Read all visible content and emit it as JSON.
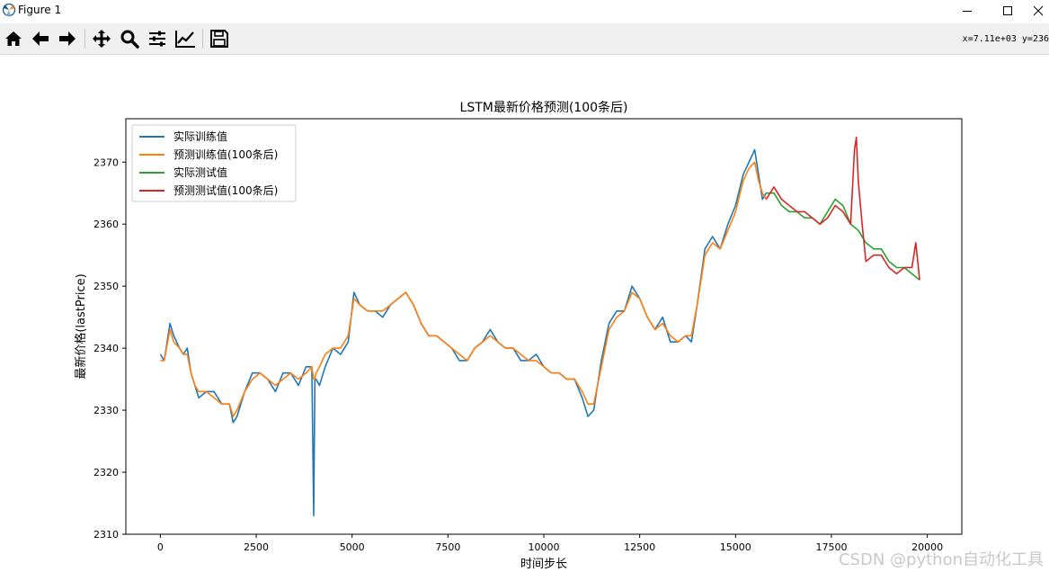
{
  "window": {
    "title": "Figure 1",
    "minimize_label": "minimize",
    "maximize_label": "maximize",
    "close_label": "close"
  },
  "toolbar": {
    "buttons": [
      {
        "name": "home",
        "icon": "home-icon"
      },
      {
        "name": "back",
        "icon": "arrow-left-icon"
      },
      {
        "name": "forward",
        "icon": "arrow-right-icon"
      },
      {
        "name": "pan",
        "icon": "move-icon"
      },
      {
        "name": "zoom",
        "icon": "magnifier-icon"
      },
      {
        "name": "subplots",
        "icon": "sliders-icon"
      },
      {
        "name": "edit-axes",
        "icon": "line-chart-icon"
      },
      {
        "name": "save",
        "icon": "floppy-icon"
      }
    ],
    "coords": "x=7.11e+03 y=236"
  },
  "watermark": "CSDN @python自动化工具",
  "chart_data": {
    "type": "line",
    "title": "LSTM最新价格预测(100条后)",
    "xlabel": "时间步长",
    "ylabel": "最新价格(lastPrice)",
    "xlim": [
      -900,
      20900
    ],
    "ylim": [
      2310,
      2377
    ],
    "xticks": [
      0,
      2500,
      5000,
      7500,
      10000,
      12500,
      15000,
      17500,
      20000
    ],
    "xtick_labels": [
      "0",
      "2500",
      "5000",
      "7500",
      "10000",
      "12500",
      "15000",
      "17500",
      "20000"
    ],
    "yticks": [
      2310,
      2320,
      2330,
      2340,
      2350,
      2360,
      2370
    ],
    "ytick_labels": [
      "2310",
      "2320",
      "2330",
      "2340",
      "2350",
      "2360",
      "2370"
    ],
    "grid": false,
    "legend_position": "upper-left",
    "series": [
      {
        "name": "实际训练值",
        "color": "#1f77b4",
        "x": [
          0,
          100,
          250,
          350,
          500,
          600,
          700,
          800,
          900,
          1000,
          1200,
          1400,
          1600,
          1800,
          1900,
          2000,
          2200,
          2400,
          2600,
          2800,
          3000,
          3200,
          3400,
          3600,
          3800,
          3950,
          4000,
          4030,
          4060,
          4150,
          4300,
          4500,
          4700,
          4900,
          5050,
          5200,
          5400,
          5600,
          5800,
          6000,
          6200,
          6400,
          6600,
          6800,
          7000,
          7200,
          7400,
          7600,
          7800,
          8000,
          8200,
          8400,
          8600,
          8800,
          9000,
          9200,
          9400,
          9600,
          9800,
          10000,
          10200,
          10400,
          10600,
          10800,
          11000,
          11150,
          11300,
          11500,
          11700,
          11900,
          12100,
          12300,
          12500,
          12700,
          12900,
          13100,
          13300,
          13500,
          13700,
          13850,
          14000,
          14200,
          14400,
          14600,
          14800,
          15000,
          15200,
          15350,
          15500,
          15600,
          15700,
          15800
        ],
        "y": [
          2339,
          2338,
          2344,
          2342,
          2340,
          2339,
          2340,
          2336,
          2334,
          2332,
          2333,
          2333,
          2331,
          2331,
          2328,
          2329,
          2333,
          2336,
          2336,
          2335,
          2333,
          2336,
          2336,
          2334,
          2337,
          2337,
          2313,
          2335,
          2335,
          2334,
          2337,
          2340,
          2339,
          2341,
          2349,
          2347,
          2346,
          2346,
          2345,
          2347,
          2348,
          2349,
          2347,
          2344,
          2342,
          2342,
          2341,
          2340,
          2338,
          2338,
          2340,
          2341,
          2343,
          2341,
          2340,
          2340,
          2338,
          2338,
          2339,
          2337,
          2336,
          2336,
          2335,
          2335,
          2332,
          2329,
          2330,
          2338,
          2344,
          2346,
          2346,
          2350,
          2348,
          2345,
          2343,
          2345,
          2341,
          2341,
          2342,
          2341,
          2347,
          2356,
          2358,
          2356,
          2360,
          2363,
          2368,
          2370,
          2372,
          2368,
          2364,
          2365
        ]
      },
      {
        "name": "预测训练值(100条后)",
        "color": "#ff7f0e",
        "x": [
          0,
          100,
          250,
          350,
          500,
          600,
          700,
          800,
          900,
          1000,
          1200,
          1400,
          1600,
          1800,
          1900,
          2000,
          2200,
          2400,
          2600,
          2800,
          3000,
          3200,
          3400,
          3600,
          3800,
          3950,
          4000,
          4030,
          4060,
          4150,
          4300,
          4500,
          4700,
          4900,
          5050,
          5200,
          5400,
          5600,
          5800,
          6000,
          6200,
          6400,
          6600,
          6800,
          7000,
          7200,
          7400,
          7600,
          7800,
          8000,
          8200,
          8400,
          8600,
          8800,
          9000,
          9200,
          9400,
          9600,
          9800,
          10000,
          10200,
          10400,
          10600,
          10800,
          11000,
          11150,
          11300,
          11500,
          11700,
          11900,
          12100,
          12300,
          12500,
          12700,
          12900,
          13100,
          13300,
          13500,
          13700,
          13850,
          14000,
          14200,
          14400,
          14600,
          14800,
          15000,
          15200,
          15350,
          15500,
          15600,
          15700,
          15800
        ],
        "y": [
          2338,
          2338,
          2343,
          2341,
          2340,
          2339,
          2339,
          2336,
          2334,
          2333,
          2333,
          2332,
          2331,
          2331,
          2329,
          2330,
          2333,
          2335,
          2336,
          2335,
          2334,
          2335,
          2336,
          2335,
          2336,
          2337,
          2335,
          2335,
          2336,
          2337,
          2339,
          2340,
          2340,
          2342,
          2348,
          2347,
          2346,
          2346,
          2346,
          2347,
          2348,
          2349,
          2347,
          2344,
          2342,
          2342,
          2341,
          2340,
          2339,
          2338,
          2340,
          2341,
          2342,
          2341,
          2340,
          2340,
          2339,
          2338,
          2338,
          2337,
          2336,
          2336,
          2335,
          2335,
          2333,
          2331,
          2331,
          2337,
          2343,
          2345,
          2346,
          2349,
          2348,
          2345,
          2343,
          2344,
          2342,
          2341,
          2342,
          2342,
          2347,
          2355,
          2357,
          2356,
          2359,
          2362,
          2367,
          2369,
          2370,
          2367,
          2365,
          2364
        ]
      },
      {
        "name": "实际测试值",
        "color": "#2ca02c",
        "x": [
          15800,
          16000,
          16200,
          16400,
          16600,
          16800,
          17000,
          17200,
          17400,
          17600,
          17800,
          18000,
          18200,
          18400,
          18600,
          18800,
          19000,
          19200,
          19400,
          19600,
          19800
        ],
        "y": [
          2365,
          2365,
          2363,
          2362,
          2362,
          2361,
          2361,
          2360,
          2362,
          2364,
          2363,
          2360,
          2359,
          2357,
          2356,
          2356,
          2354,
          2353,
          2353,
          2352,
          2351
        ]
      },
      {
        "name": "预测测试值(100条后)",
        "color": "#d62728",
        "x": [
          15800,
          16000,
          16200,
          16400,
          16600,
          16800,
          17000,
          17200,
          17400,
          17600,
          17800,
          18000,
          18100,
          18150,
          18200,
          18300,
          18400,
          18600,
          18800,
          19000,
          19200,
          19400,
          19600,
          19700,
          19800
        ],
        "y": [
          2364,
          2366,
          2364,
          2363,
          2362,
          2362,
          2361,
          2360,
          2361,
          2363,
          2362,
          2360,
          2372,
          2374,
          2367,
          2360,
          2354,
          2355,
          2355,
          2353,
          2352,
          2353,
          2353,
          2357,
          2351
        ]
      }
    ]
  }
}
